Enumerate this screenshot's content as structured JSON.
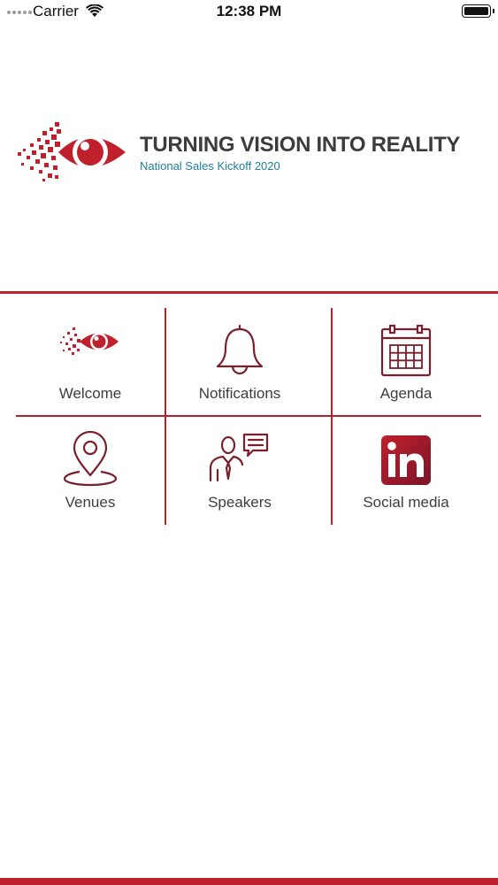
{
  "status_bar": {
    "carrier": "Carrier",
    "time": "12:38 PM"
  },
  "banner": {
    "title": "TURNING VISION INTO REALITY",
    "subtitle": "National Sales Kickoff 2020"
  },
  "menu": {
    "items": [
      {
        "label": "Welcome",
        "icon": "eye-logo-icon"
      },
      {
        "label": "Notifications",
        "icon": "bell-icon"
      },
      {
        "label": "Agenda",
        "icon": "calendar-icon"
      },
      {
        "label": "Venues",
        "icon": "location-pin-icon"
      },
      {
        "label": "Speakers",
        "icon": "speaker-icon"
      },
      {
        "label": "Social media",
        "icon": "linkedin-icon"
      }
    ]
  },
  "colors": {
    "accent_red": "#c0202c",
    "icon_maroon": "#7a1f2b",
    "subtitle_teal": "#1f7f9c"
  }
}
